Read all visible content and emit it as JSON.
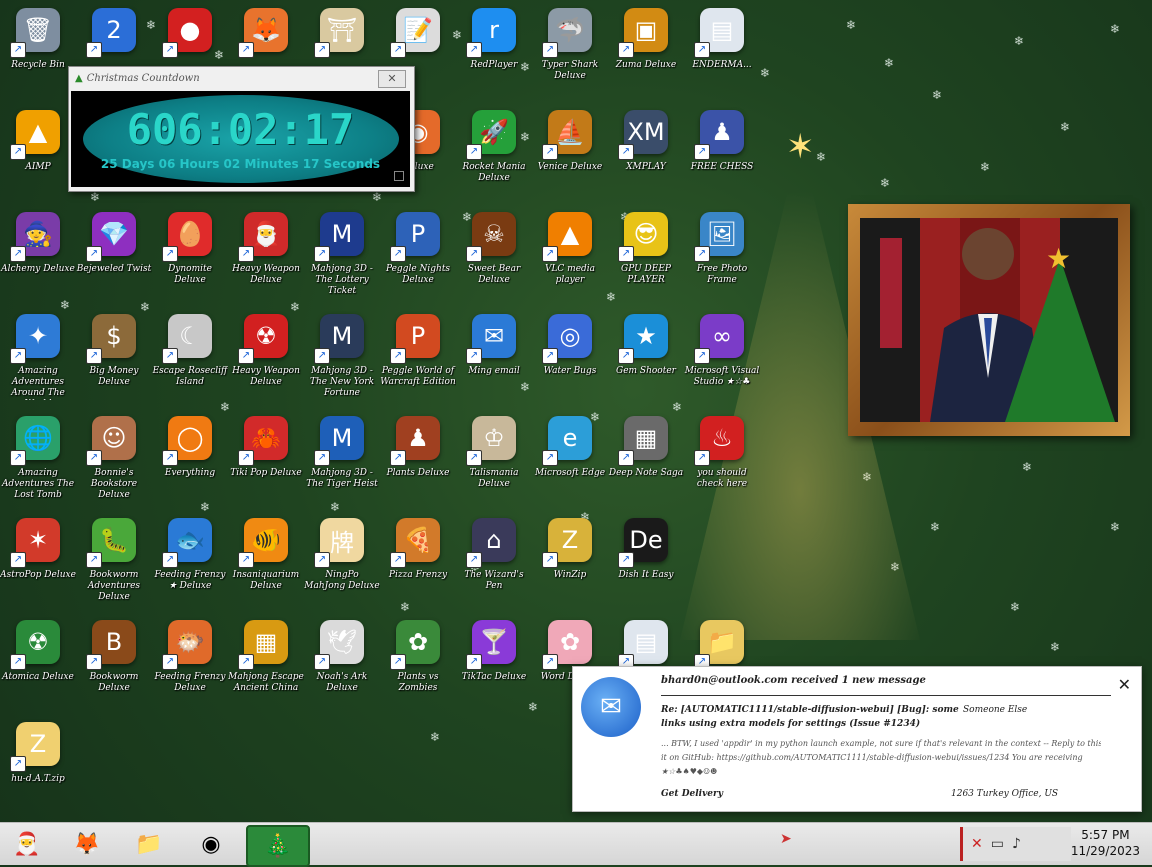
{
  "desktop_icons": [
    {
      "label": "Recycle Bin",
      "icon": "recycle-bin-icon",
      "symbol": "🗑",
      "color": "#7e8ea0"
    },
    {
      "label": "",
      "icon": "badge-2-icon",
      "symbol": "2",
      "color": "#2b6ed7"
    },
    {
      "label": "",
      "icon": "red-fluffy-icon",
      "symbol": "●",
      "color": "#d32020"
    },
    {
      "label": "",
      "icon": "firefox-icon",
      "symbol": "🦊",
      "color": "#e8732d"
    },
    {
      "label": "",
      "icon": "shrine-icon",
      "symbol": "⛩",
      "color": "#d9c9a0"
    },
    {
      "label": "",
      "icon": "notepad-icon",
      "symbol": "📝",
      "color": "#dcdcdc"
    },
    {
      "label": "RedPlayer",
      "icon": "redplayer-icon",
      "symbol": "r",
      "color": "#1e8ef0"
    },
    {
      "label": "Typer Shark Deluxe",
      "icon": "shark-icon",
      "symbol": "🦈",
      "color": "#8c9aa6"
    },
    {
      "label": "Zuma Deluxe",
      "icon": "zuma-icon",
      "symbol": "▣",
      "color": "#d28b13"
    },
    {
      "label": "ENDERMA...",
      "icon": "window-icon",
      "symbol": "▤",
      "color": "#dfe6ee"
    },
    {
      "label": "AIMP",
      "icon": "aimp-icon",
      "symbol": "▲",
      "color": "#f0a000"
    },
    {
      "label": "",
      "icon": "hidden-icon",
      "symbol": "",
      "color": "transparent"
    },
    {
      "label": "",
      "icon": "hidden-icon",
      "symbol": "",
      "color": "transparent"
    },
    {
      "label": "",
      "icon": "hidden-icon",
      "symbol": "",
      "color": "transparent"
    },
    {
      "label": "",
      "icon": "hidden-icon",
      "symbol": "",
      "color": "transparent"
    },
    {
      "label": "Deluxe",
      "icon": "orb-icon",
      "symbol": "◉",
      "color": "#e46a2a"
    },
    {
      "label": "Rocket Mania Deluxe",
      "icon": "rocket-icon",
      "symbol": "🚀",
      "color": "#25a03a"
    },
    {
      "label": "Venice Deluxe",
      "icon": "gondola-icon",
      "symbol": "⛵",
      "color": "#c27a18"
    },
    {
      "label": "XMPLAY",
      "icon": "xmplay-icon",
      "symbol": "XM",
      "color": "#3a4d6a"
    },
    {
      "label": "FREE CHESS",
      "icon": "chess-icon",
      "symbol": "♟",
      "color": "#3b53a8"
    },
    {
      "label": "Alchemy Deluxe",
      "icon": "wizard-icon",
      "symbol": "🧙",
      "color": "#7a3ca8"
    },
    {
      "label": "Bejeweled Twist",
      "icon": "gem-icon",
      "symbol": "💎",
      "color": "#8e2fc0"
    },
    {
      "label": "Dynomite Deluxe",
      "icon": "egg-icon",
      "symbol": "🥚",
      "color": "#e02b2b"
    },
    {
      "label": "Heavy Weapon Deluxe",
      "icon": "gnome-icon",
      "symbol": "🎅",
      "color": "#cf2a2a"
    },
    {
      "label": "Mahjong 3D - The Lottery Ticket",
      "icon": "mpl-icon",
      "symbol": "M",
      "color": "#1e3b8e"
    },
    {
      "label": "Peggle Nights Deluxe",
      "icon": "peggle-icon",
      "symbol": "P",
      "color": "#2d62b8"
    },
    {
      "label": "Sweet Bear Deluxe",
      "icon": "pirate-icon",
      "symbol": "☠",
      "color": "#7a3b12"
    },
    {
      "label": "VLC media player",
      "icon": "vlc-icon",
      "symbol": "▲",
      "color": "#f07f00"
    },
    {
      "label": "GPU DEEP PLAYER",
      "icon": "emoji-icon",
      "symbol": "😎",
      "color": "#e8c317"
    },
    {
      "label": "Free Photo Frame",
      "icon": "photos-icon",
      "symbol": "🖼",
      "color": "#3a86c8"
    },
    {
      "label": "Amazing Adventures Around The World",
      "icon": "compass-icon",
      "symbol": "✦",
      "color": "#2e7bd6"
    },
    {
      "label": "Big Money Deluxe",
      "icon": "moneybag-icon",
      "symbol": "$",
      "color": "#8c6a3a"
    },
    {
      "label": "Escape Rosecliff Island",
      "icon": "moon-icon",
      "symbol": "☾",
      "color": "#c8c8c8"
    },
    {
      "label": "Heavy Weapon Deluxe",
      "icon": "nuclear-icon",
      "symbol": "☢",
      "color": "#d22020"
    },
    {
      "label": "Mahjong 3D - The New York Fortune",
      "icon": "mpl-icon",
      "symbol": "M",
      "color": "#2a3b5a"
    },
    {
      "label": "Peggle World of Warcraft Edition",
      "icon": "peggle-icon",
      "symbol": "P",
      "color": "#d24a20"
    },
    {
      "label": "Ming email",
      "icon": "thunderbird-icon",
      "symbol": "✉",
      "color": "#2b7ad6"
    },
    {
      "label": "Water Bugs",
      "icon": "bugs-icon",
      "symbol": "◎",
      "color": "#3a6bd8"
    },
    {
      "label": "Gem Shooter",
      "icon": "stars-icon",
      "symbol": "★",
      "color": "#1b8fd8"
    },
    {
      "label": "Microsoft Visual Studio ★☆♣",
      "icon": "vs-icon",
      "symbol": "∞",
      "color": "#7b3cc8"
    },
    {
      "label": "Amazing Adventures The Lost Tomb",
      "icon": "globe-icon",
      "symbol": "🌐",
      "color": "#2aa06a"
    },
    {
      "label": "Bonnie's Bookstore Deluxe",
      "icon": "bonnie-icon",
      "symbol": "☺",
      "color": "#b0704a"
    },
    {
      "label": "Everything",
      "icon": "everything-icon",
      "symbol": "◯",
      "color": "#f07a12"
    },
    {
      "label": "Tiki Pop Deluxe",
      "icon": "crab-icon",
      "symbol": "🦀",
      "color": "#d22a2a"
    },
    {
      "label": "Mahjong 3D - The Tiger Heist",
      "icon": "mpl-icon",
      "symbol": "M",
      "color": "#1e5fb8"
    },
    {
      "label": "Plants Deluxe",
      "icon": "elf-icon",
      "symbol": "♟",
      "color": "#a04020"
    },
    {
      "label": "Talismania Deluxe",
      "icon": "king-icon",
      "symbol": "♔",
      "color": "#c8b89a"
    },
    {
      "label": "Microsoft Edge",
      "icon": "edge-icon",
      "symbol": "e",
      "color": "#2c9ed8"
    },
    {
      "label": "Deep Note Saga",
      "icon": "windows-stack-icon",
      "symbol": "▦",
      "color": "#6a6a6a"
    },
    {
      "label": "you should check here",
      "icon": "dragon-icon",
      "symbol": "♨",
      "color": "#d22020"
    },
    {
      "label": "AstroPop Deluxe",
      "icon": "astropop-icon",
      "symbol": "✶",
      "color": "#d23a2a"
    },
    {
      "label": "Bookworm Adventures Deluxe",
      "icon": "worm-icon",
      "symbol": "🐛",
      "color": "#4aa83a"
    },
    {
      "label": "Feeding Frenzy ★ Deluxe",
      "icon": "fish-icon",
      "symbol": "🐟",
      "color": "#2a7ad6"
    },
    {
      "label": "Insaniquarium Deluxe",
      "icon": "goldfish-icon",
      "symbol": "🐠",
      "color": "#f08a12"
    },
    {
      "label": "NingPo MahJong Deluxe",
      "icon": "ningpo-icon",
      "symbol": "牌",
      "color": "#f0d8a0"
    },
    {
      "label": "Pizza Frenzy",
      "icon": "pizza-icon",
      "symbol": "🍕",
      "color": "#d27a2a"
    },
    {
      "label": "The Wizard's Pen",
      "icon": "house-icon",
      "symbol": "⌂",
      "color": "#3a3a5a"
    },
    {
      "label": "WinZip",
      "icon": "winzip-icon",
      "symbol": "Z",
      "color": "#d8b23a"
    },
    {
      "label": "Dish It Easy",
      "icon": "de-icon",
      "symbol": "De",
      "color": "#1a1a1a"
    },
    {
      "label": "",
      "icon": "hidden-icon",
      "symbol": "",
      "color": "transparent"
    },
    {
      "label": "Atomica Deluxe",
      "icon": "radiation-icon",
      "symbol": "☢",
      "color": "#2a8a3a"
    },
    {
      "label": "Bookworm Deluxe",
      "icon": "book-icon",
      "symbol": "B",
      "color": "#8a4a1a"
    },
    {
      "label": "Feeding Frenzy Deluxe",
      "icon": "angelfish-icon",
      "symbol": "🐡",
      "color": "#e06a2a"
    },
    {
      "label": "Mahjong Escape Ancient China",
      "icon": "mahjong-icon",
      "symbol": "▦",
      "color": "#d89a12"
    },
    {
      "label": "Noah's Ark Deluxe",
      "icon": "dove-icon",
      "symbol": "🕊",
      "color": "#dadada"
    },
    {
      "label": "Plants vs Zombies",
      "icon": "flower-icon",
      "symbol": "✿",
      "color": "#3a8a3a"
    },
    {
      "label": "TikTac Deluxe",
      "icon": "cocktail-icon",
      "symbol": "🍸",
      "color": "#8a3ad8"
    },
    {
      "label": "Word Deluxe",
      "icon": "blossom-icon",
      "symbol": "✿",
      "color": "#f0a8b8"
    },
    {
      "label": "",
      "icon": "window-icon",
      "symbol": "▤",
      "color": "#dfe6ee"
    },
    {
      "label": "",
      "icon": "folder-icon",
      "symbol": "📁",
      "color": "#e8c860"
    },
    {
      "label": "hu-d.A.T.zip",
      "icon": "zip-folder-icon",
      "symbol": "Z",
      "color": "#f0d070"
    }
  ],
  "countdown": {
    "title": "Christmas Countdown",
    "time": "606:02:17",
    "detail": "25 Days 06 Hours 02 Minutes 17 Seconds",
    "close": "✕"
  },
  "notification": {
    "header": "bhard0n@outlook.com received 1 new message",
    "subject": "Re: [AUTOMATIC1111/stable-diffusion-webui] [Bug]: some",
    "subject_line2": "links using extra models for settings (Issue #1234)",
    "sender": "Someone Else",
    "body_line1": "... BTW, I used 'appdir' in my python launch example, not sure if that's relevant in the context -- Reply to this email directly or view",
    "body_line2": "it on GitHub: https://github.com/AUTOMATIC1111/stable-diffusion-webui/issues/1234 You are receiving",
    "body_line3": "★☆♣♠♥◆☺☻",
    "footer_left": "Get Delivery",
    "footer_right": "1263 Turkey Office, US",
    "close": "✕"
  },
  "taskbar": {
    "buttons": [
      {
        "name": "santa-start-button",
        "symbol": "🎅"
      },
      {
        "name": "taskbar-firefox-button",
        "symbol": "🦊"
      },
      {
        "name": "taskbar-explorer-button",
        "symbol": "📁"
      },
      {
        "name": "taskbar-chrome-button",
        "symbol": "◉"
      },
      {
        "name": "taskbar-countdown-button",
        "symbol": "🎄"
      }
    ],
    "time": "5:57 PM",
    "date": "11/29/2023"
  }
}
